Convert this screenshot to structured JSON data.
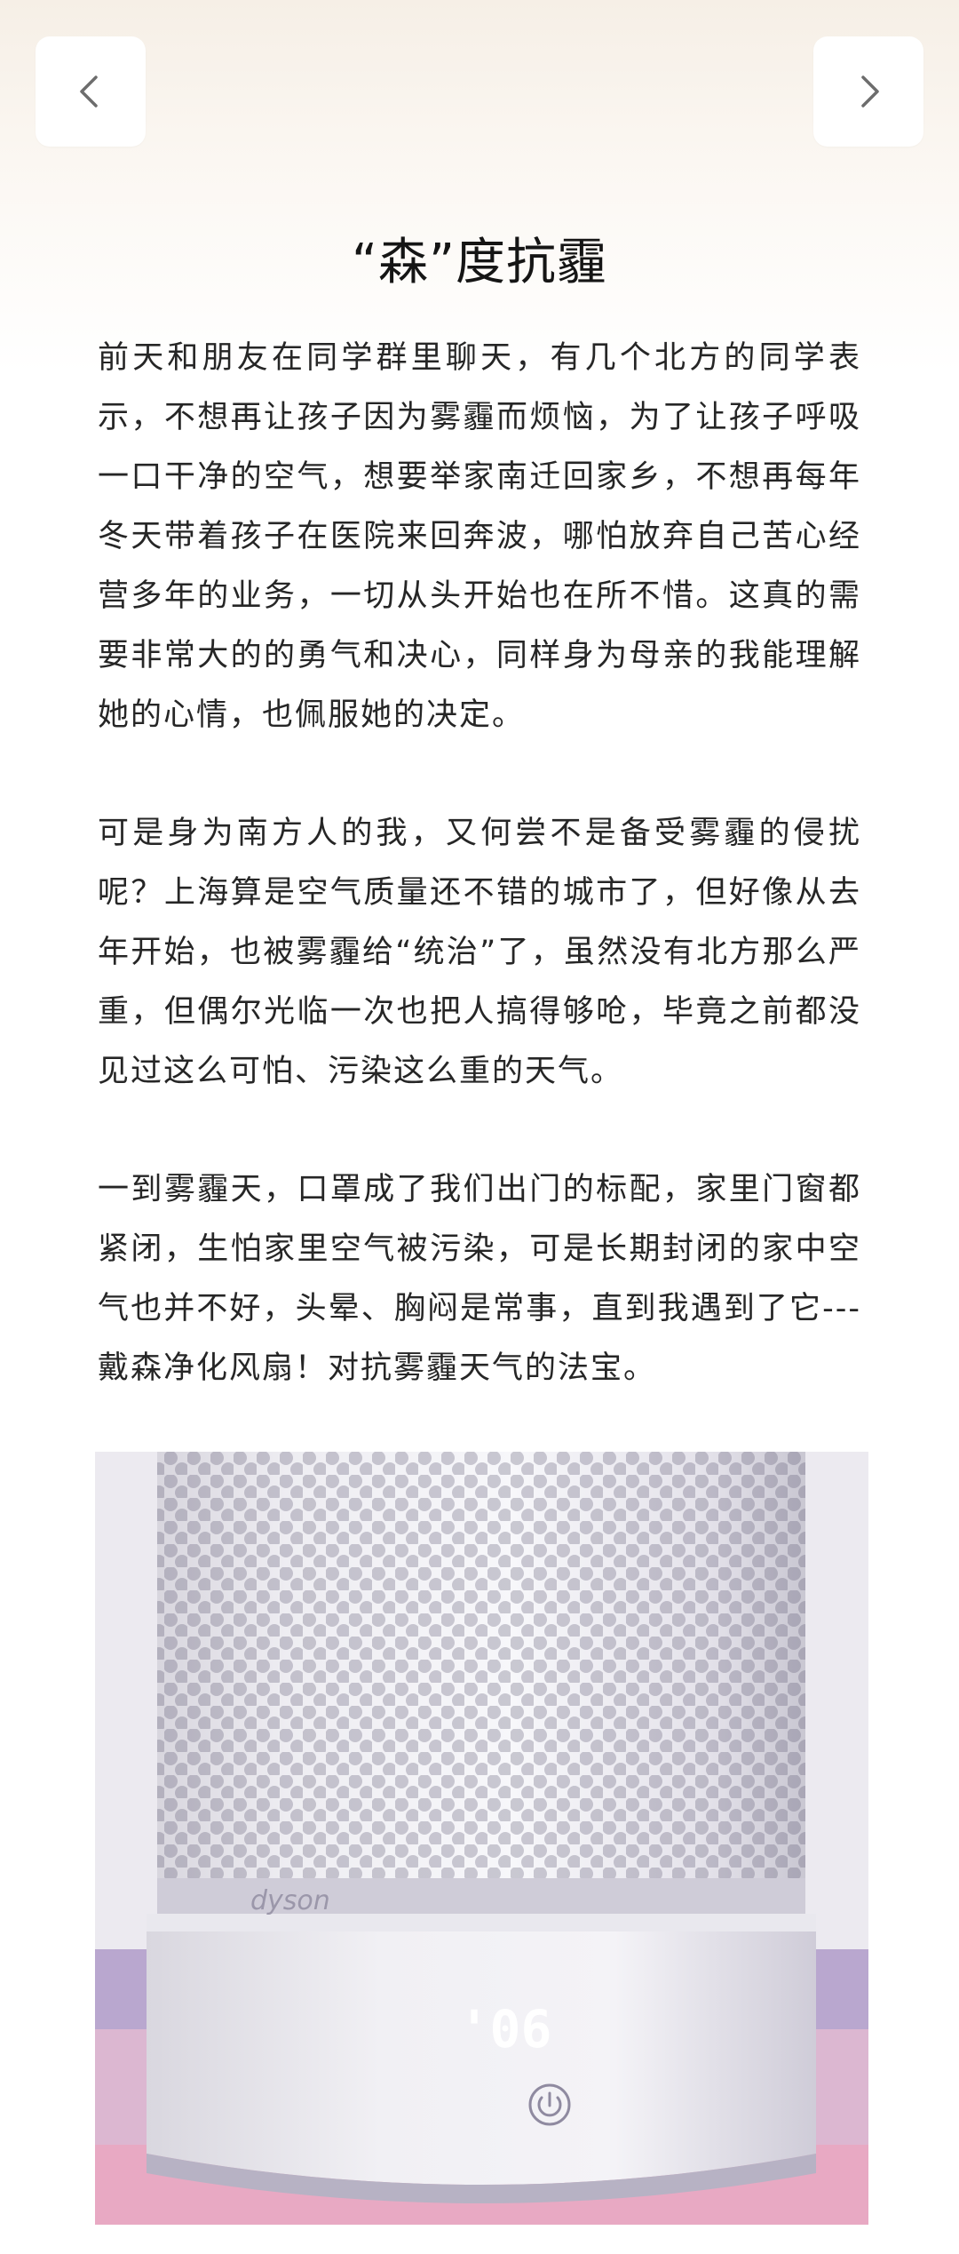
{
  "navigation": {
    "prev_icon": "chevron-left-icon",
    "next_icon": "chevron-right-icon"
  },
  "article": {
    "title": "“森”度抗霾",
    "paragraphs": [
      "前天和朋友在同学群里聊天，有几个北方的同学表示，不想再让孩子因为雾霾而烦恼，为了让孩子呼吸一口干净的空气，想要举家南迁回家乡，不想再每年冬天带着孩子在医院来回奔波，哪怕放弃自己苦心经营多年的业务，一切从头开始也在所不惜。这真的需要非常大的的勇气和决心，同样身为母亲的我能理解她的心情，也佩服她的决定。",
      "可是身为南方人的我，又何尝不是备受雾霾的侵扰呢？上海算是空气质量还不错的城市了，但好像从去年开始，也被雾霾给“统治”了，虽然没有北方那么严重，但偶尔光临一次也把人搞得够呛，毕竟之前都没见过这么可怕、污染这么重的天气。",
      "一到雾霾天，口罩成了我们出门的标配，家里门窗都紧闭，生怕家里空气被污染，可是长期封闭的家中空气也并不好，头晕、胸闷是常事，直到我遇到了它---戴森净化风扇！对抗雾霾天气的法宝。"
    ]
  },
  "photo": {
    "brand_text": "dyson",
    "display_text": "'06",
    "power_icon": "power-icon"
  }
}
